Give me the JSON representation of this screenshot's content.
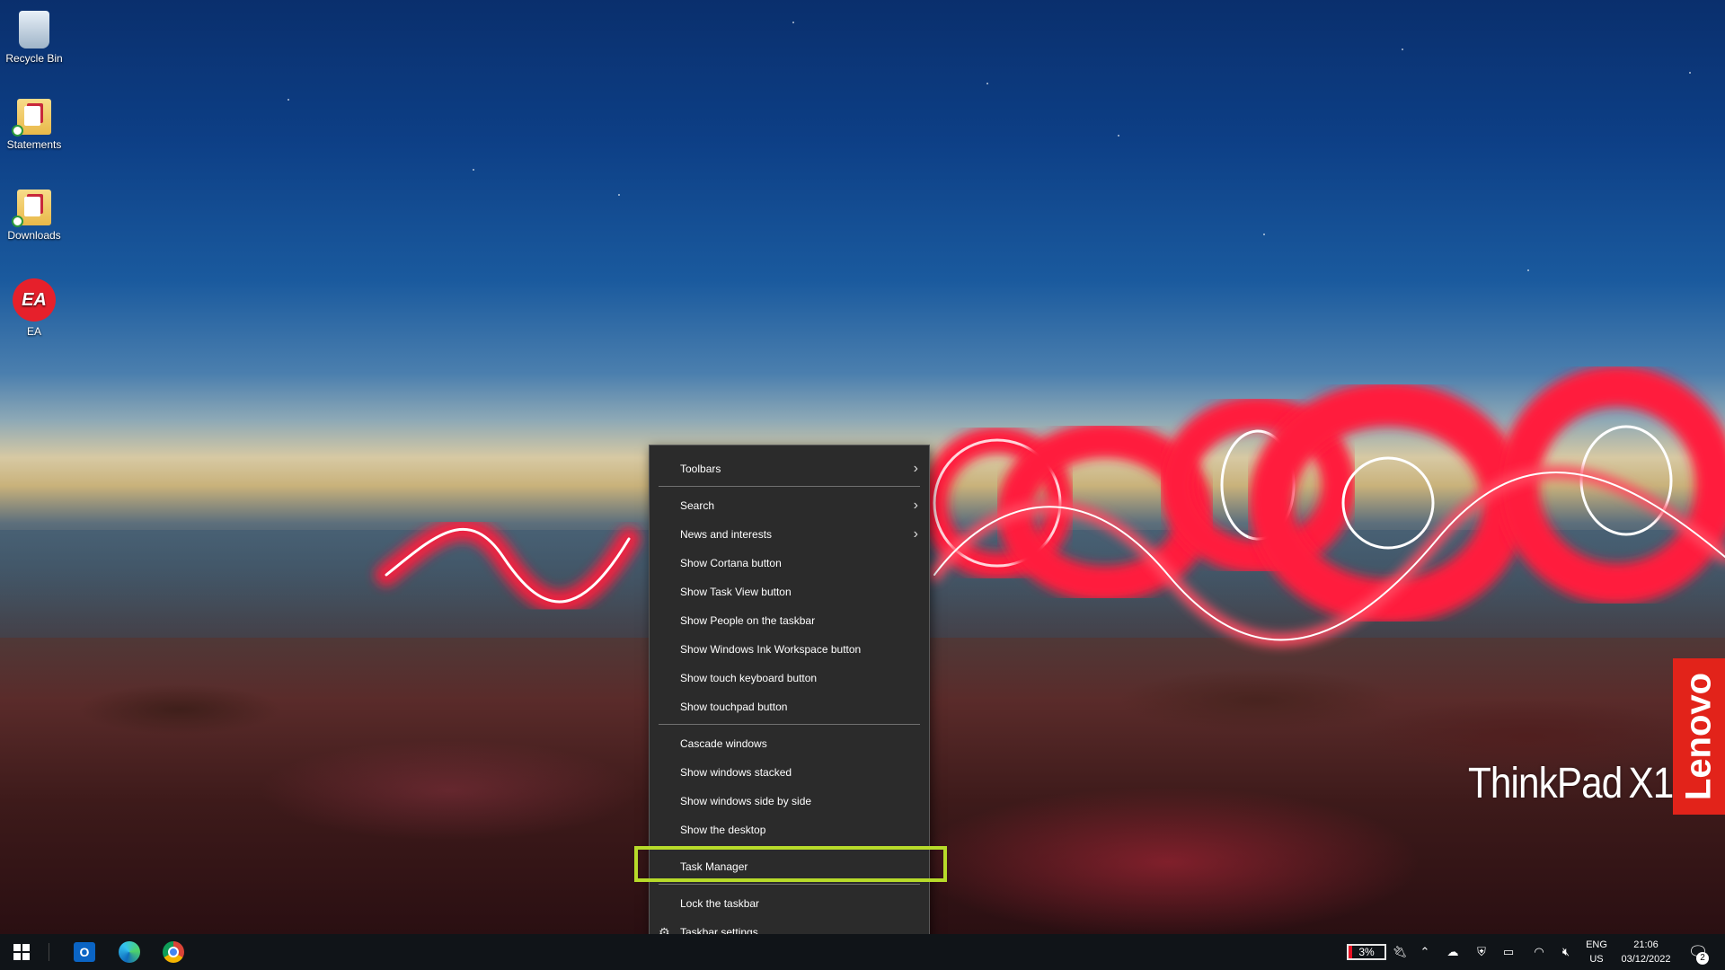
{
  "desktop": {
    "icons": [
      {
        "label": "Recycle Bin",
        "icon": "recycle-bin-icon"
      },
      {
        "label": "Statements",
        "icon": "folder-icon"
      },
      {
        "label": "Downloads",
        "icon": "folder-icon"
      },
      {
        "label": "EA",
        "icon": "ea-app-icon",
        "glyph": "EA"
      }
    ],
    "branding": {
      "thinkpad": "ThinkPad",
      "model": "X1",
      "lenovo": "Lenovo"
    }
  },
  "context_menu": {
    "items": [
      {
        "label": "Toolbars",
        "submenu": true
      },
      {
        "label": "Search",
        "submenu": true
      },
      {
        "label": "News and interests",
        "submenu": true
      },
      {
        "label": "Show Cortana button"
      },
      {
        "label": "Show Task View button"
      },
      {
        "label": "Show People on the taskbar"
      },
      {
        "label": "Show Windows Ink Workspace button"
      },
      {
        "label": "Show touch keyboard button"
      },
      {
        "label": "Show touchpad button"
      },
      {
        "label": "Cascade windows"
      },
      {
        "label": "Show windows stacked"
      },
      {
        "label": "Show windows side by side"
      },
      {
        "label": "Show the desktop"
      },
      {
        "label": "Task Manager",
        "highlighted": true
      },
      {
        "label": "Lock the taskbar"
      },
      {
        "label": "Taskbar settings",
        "icon": "gear-icon"
      }
    ],
    "highlight_color": "#b7db2a"
  },
  "taskbar": {
    "pinned": [
      {
        "name": "start-button",
        "icon": "windows-logo-icon"
      },
      {
        "name": "outlook",
        "icon": "outlook-icon",
        "glyph": "O"
      },
      {
        "name": "edge",
        "icon": "edge-icon"
      },
      {
        "name": "chrome",
        "icon": "chrome-icon"
      }
    ],
    "tray": {
      "battery": "3%",
      "language": "ENG",
      "region": "US",
      "time": "21:06",
      "date": "03/12/2022",
      "notifications": "2"
    }
  }
}
